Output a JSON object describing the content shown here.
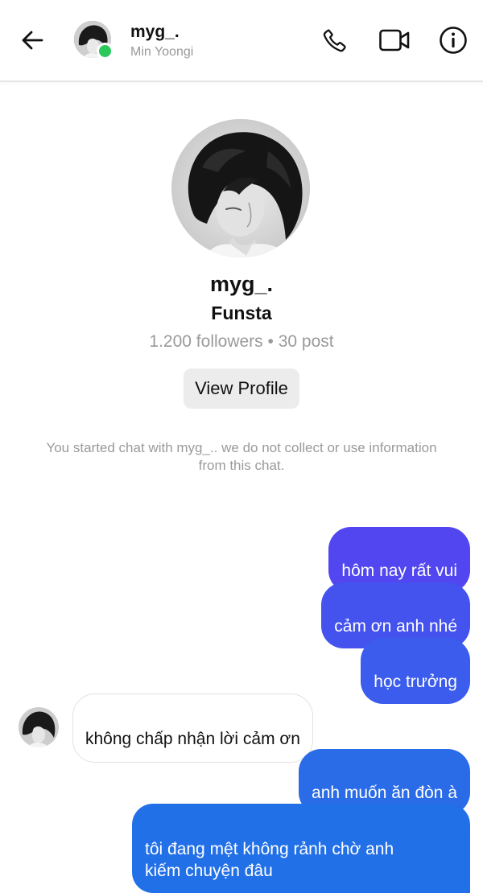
{
  "header": {
    "username": "myg_.",
    "display_name": "Min Yoongi",
    "icons": [
      "back-arrow-icon",
      "phone-icon",
      "video-camera-icon",
      "info-icon"
    ],
    "online_color": "#2bc85a"
  },
  "profile": {
    "username": "myg_.",
    "account_label": "Funsta",
    "stats": "1.200 followers • 30 post",
    "view_profile_label": "View Profile"
  },
  "notice": "You started chat with myg_.. we do not collect or use information\nfrom this chat.",
  "messages": [
    {
      "direction": "outgoing",
      "text": "hôm nay rất vui",
      "color": "#5146f0"
    },
    {
      "direction": "outgoing",
      "text": "cảm ơn anh nhé",
      "color": "#4452ee"
    },
    {
      "direction": "outgoing",
      "text": "học trưởng",
      "color": "#3b5cec"
    },
    {
      "direction": "incoming",
      "text": "không chấp nhận lời cảm ơn"
    },
    {
      "direction": "outgoing",
      "text": "anh muốn ăn đòn à",
      "color": "#2a6be8"
    },
    {
      "direction": "outgoing",
      "text": "tôi đang mệt không rảnh chờ anh\nkiếm chuyện đâu",
      "color": "#2270e8"
    }
  ],
  "colors": {
    "muted_text": "#9a9a9a",
    "button_bg": "#ececec",
    "incoming_border": "#e2e2e2"
  }
}
